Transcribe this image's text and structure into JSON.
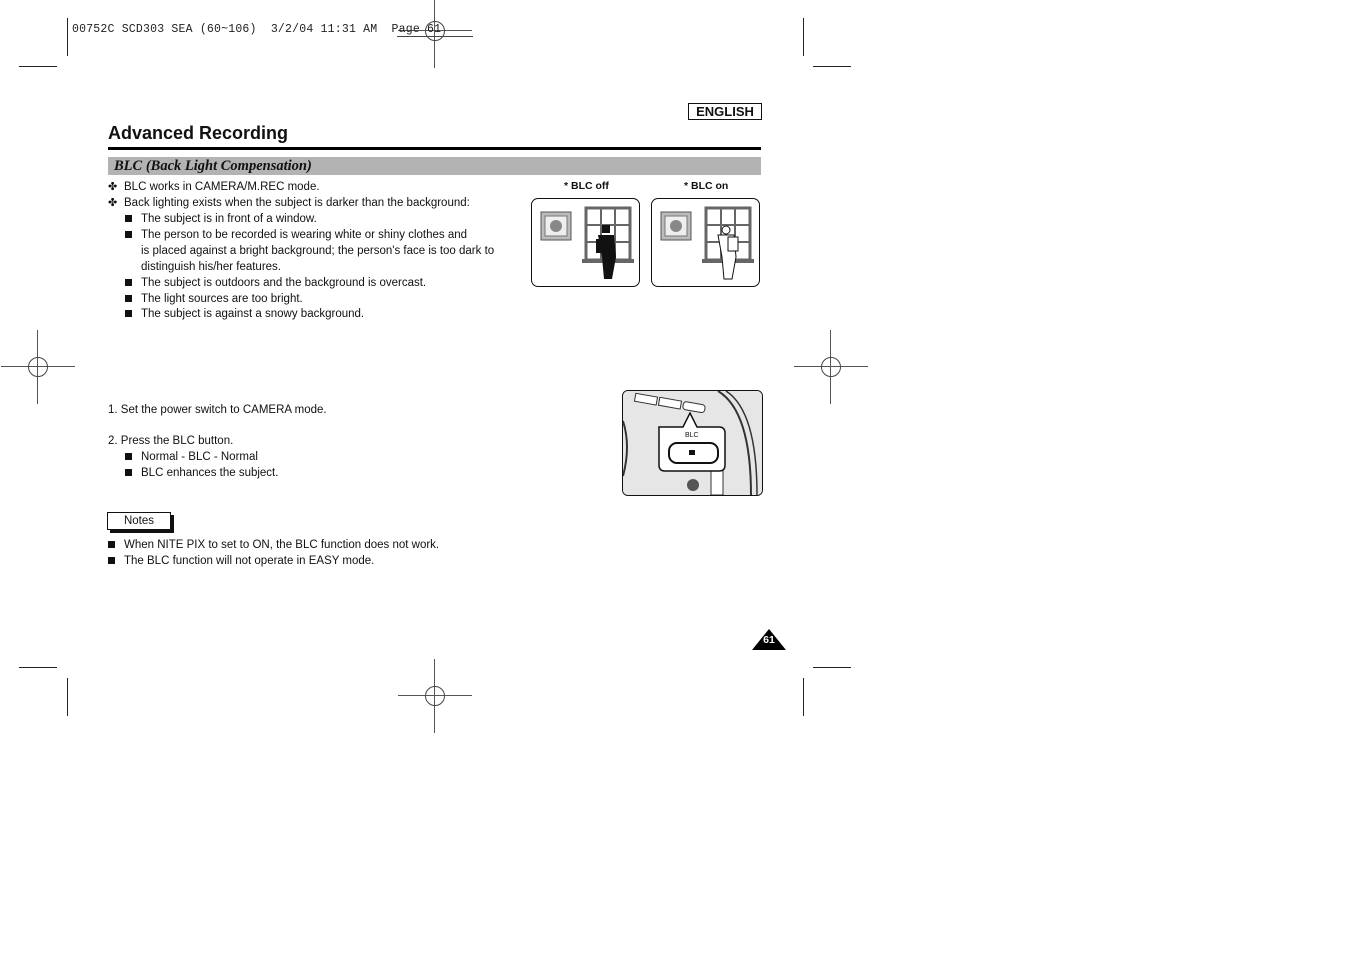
{
  "print_slug": "00752C SCD303 SEA (60~106)  3/2/04 11:31 AM  Page 61",
  "language_badge": "ENGLISH",
  "page_title": "Advanced Recording",
  "section_title": "BLC (Back Light Compensation)",
  "intro": {
    "points": [
      {
        "text": "BLC works in CAMERA/M.REC mode."
      },
      {
        "text": "Back lighting exists when the subject is darker than the background:"
      }
    ],
    "sub_points": [
      [
        "The subject is in front of a window."
      ],
      [
        "The person to be recorded is wearing white or shiny clothes and",
        "is placed against a bright background; the person's face is too dark to",
        "distinguish his/her features."
      ],
      [
        "The subject is outdoors and the background is overcast."
      ],
      [
        "The light sources are too bright."
      ],
      [
        "The subject is against a snowy background."
      ]
    ]
  },
  "illustrations": {
    "blc_off_caption": "* BLC off",
    "blc_on_caption": "* BLC on",
    "button_label": "BLC"
  },
  "steps": [
    {
      "text": "1.  Set the power switch to CAMERA mode."
    },
    {
      "text": "2.  Press the BLC button."
    }
  ],
  "step2_sub": [
    "Normal - BLC - Normal",
    "BLC enhances the subject."
  ],
  "notes": {
    "label": "Notes",
    "items": [
      "When NITE PIX to set to ON, the BLC function does not work.",
      "The BLC function will not operate in EASY mode."
    ]
  },
  "page_number": "61"
}
